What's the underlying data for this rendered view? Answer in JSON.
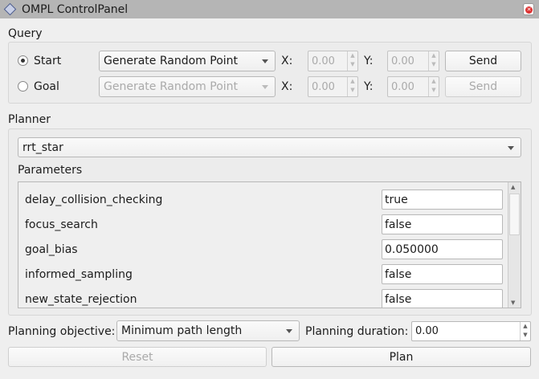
{
  "window": {
    "title": "OMPL ControlPanel"
  },
  "query": {
    "label": "Query",
    "start": {
      "label": "Start",
      "selected": true,
      "mode": "Generate Random Point",
      "x_label": "X:",
      "x": "0.00",
      "y_label": "Y:",
      "y": "0.00",
      "send": "Send"
    },
    "goal": {
      "label": "Goal",
      "selected": false,
      "mode": "Generate Random Point",
      "x_label": "X:",
      "x": "0.00",
      "y_label": "Y:",
      "y": "0.00",
      "send": "Send"
    }
  },
  "planner": {
    "label": "Planner",
    "selected": "rrt_star",
    "params_label": "Parameters",
    "params": [
      {
        "name": "delay_collision_checking",
        "value": "true"
      },
      {
        "name": "focus_search",
        "value": "false"
      },
      {
        "name": "goal_bias",
        "value": "0.050000"
      },
      {
        "name": "informed_sampling",
        "value": "false"
      },
      {
        "name": "new_state_rejection",
        "value": "false"
      }
    ]
  },
  "bottom": {
    "objective_label": "Planning objective:",
    "objective": "Minimum path length",
    "duration_label": "Planning duration:",
    "duration": "0.00",
    "reset": "Reset",
    "plan": "Plan"
  }
}
